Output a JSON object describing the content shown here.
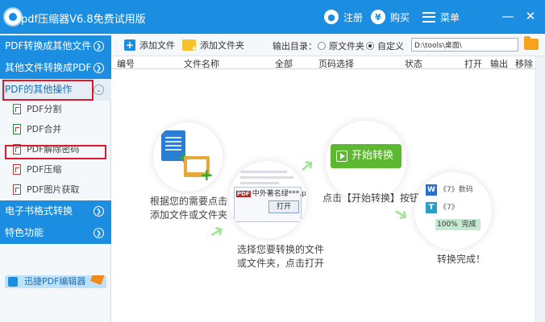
{
  "titlebar": {
    "app_title": "pdf压缩器V6.8免费试用版",
    "register_label": "注册",
    "buy_label": "购买",
    "menu_label": "菜单",
    "minimize_glyph": "—",
    "close_glyph": "✕"
  },
  "sidebar": {
    "categories": [
      {
        "label": "PDF转换成其他文件"
      },
      {
        "label": "其他文件转换成PDF"
      },
      {
        "label": "PDF的其他操作"
      },
      {
        "label": "电子书格式转换"
      },
      {
        "label": "特色功能"
      }
    ],
    "subitems": [
      {
        "label": "PDF分割"
      },
      {
        "label": "PDF合并"
      },
      {
        "label": "PDF解除密码"
      },
      {
        "label": "PDF压缩"
      },
      {
        "label": "PDF图片获取"
      }
    ],
    "banner_label": "迅捷PDF编辑器"
  },
  "toolbar": {
    "add_file_label": "添加文件",
    "add_folder_label": "添加文件夹",
    "output_dir_label": "输出目录：",
    "radio_original": "原文件夹",
    "radio_custom": "自定义",
    "output_path": "D:\\tools\\桌面\\"
  },
  "table": {
    "columns": [
      "编号",
      "文件名称",
      "全部",
      "页码选择",
      "状态",
      "打开",
      "输出",
      "移除"
    ]
  },
  "guide": {
    "step1_line1": "根据您的需要点击",
    "step1_line2": "添加文件或文件夹",
    "step2_line1": "选择您要转换的文件",
    "step2_line2": "或文件夹，点击打开",
    "step3_text": "点击【开始转换】按钮",
    "step4_text": "转换完成！",
    "dialog_filename": "中外著名绿***.pdf,\"",
    "dialog_open_label": "打开",
    "start_button_label": "开始转换",
    "result_row1": "《7》数码",
    "result_row2": "《7》",
    "progress_text": "100%",
    "progress_status": "完成",
    "progress_fraction": 1.0
  }
}
